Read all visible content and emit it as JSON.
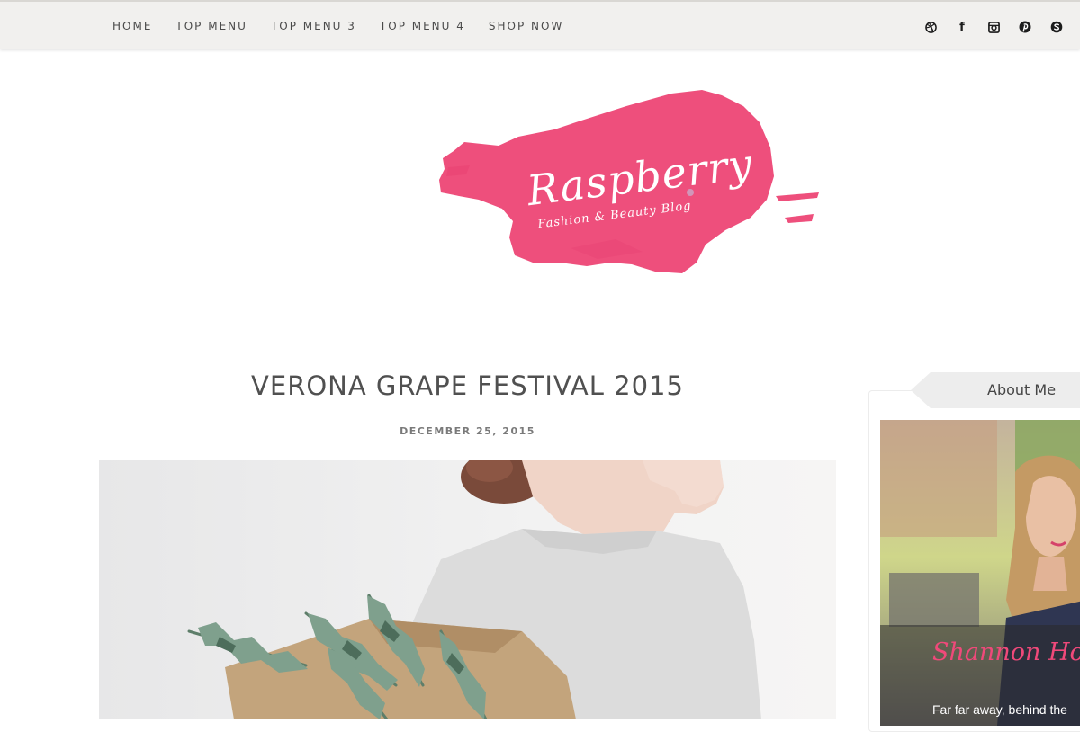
{
  "nav": {
    "items": [
      {
        "label": "HOME"
      },
      {
        "label": "TOP MENU"
      },
      {
        "label": "TOP MENU 3"
      },
      {
        "label": "TOP MENU 4"
      },
      {
        "label": "SHOP NOW"
      }
    ],
    "social": [
      {
        "icon": "dribbble-icon"
      },
      {
        "icon": "facebook-icon",
        "glyph": "f"
      },
      {
        "icon": "instagram-icon"
      },
      {
        "icon": "pinterest-icon"
      },
      {
        "icon": "skype-icon"
      }
    ]
  },
  "logo": {
    "title": "Raspberry",
    "tagline": "Fashion & Beauty Blog",
    "color": "#ee4f7c"
  },
  "post": {
    "title": "VERONA GRAPE FESTIVAL 2015",
    "date": "DECEMBER 25, 2015"
  },
  "sidebar": {
    "widget_title": "About Me",
    "name": "Shannon Holm",
    "text": "Far far away, behind the"
  },
  "colors": {
    "accent": "#f0497a",
    "nav_bg": "#f1f0ee"
  }
}
